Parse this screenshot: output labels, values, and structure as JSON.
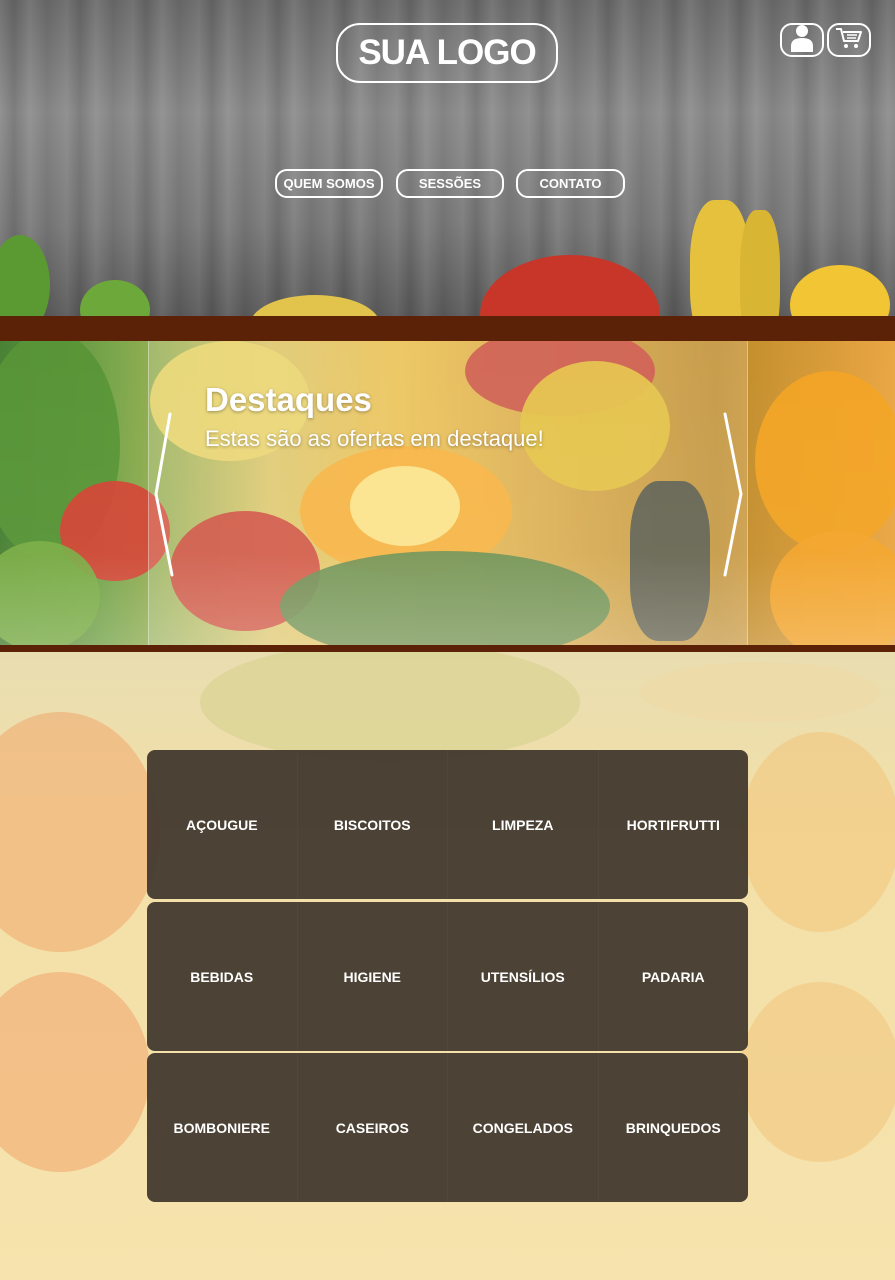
{
  "header": {
    "logo": "SUA LOGO",
    "user_icon": "user-icon",
    "cart_icon": "cart-icon"
  },
  "nav": {
    "items": [
      "QUEM SOMOS",
      "SESSÕES",
      "CONTATO"
    ]
  },
  "banner": {
    "title": "Destaques",
    "subtitle": "Estas são as ofertas em destaque!",
    "prev_icon": "chevron-left-icon",
    "next_icon": "chevron-right-icon"
  },
  "categories": {
    "rows": [
      [
        "AÇOUGUE",
        "BISCOITOS",
        "LIMPEZA",
        "HORTIFRUTTI"
      ],
      [
        "BEBIDAS",
        "HIGIENE",
        "UTENSÍLIOS",
        "PADARIA"
      ],
      [
        "BOMBONIERE",
        "CASEIROS",
        "CONGELADOS",
        "BRINQUEDOS"
      ]
    ]
  },
  "colors": {
    "accent_stripe": "#5b2207",
    "category_panel": "#3e362c",
    "page_background": "#f6e6b4",
    "text": "#ffffff"
  }
}
